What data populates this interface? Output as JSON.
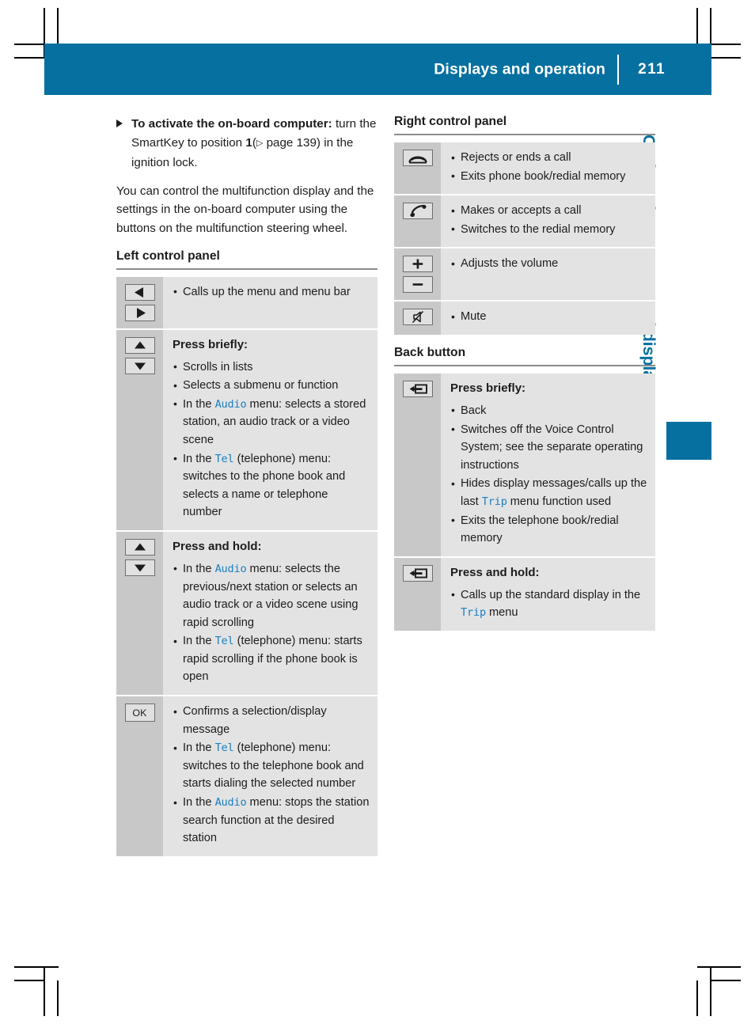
{
  "header": {
    "title": "Displays and operation",
    "page_number": "211",
    "accent_color": "#0670a0"
  },
  "side_tab": {
    "label": "On-board computer and displays",
    "color": "#0670a0"
  },
  "left_column": {
    "instruction": {
      "bold_lead": "To activate the on-board computer:",
      "rest_a": " turn the SmartKey to position ",
      "bold_one": "1",
      "rest_b": "(",
      "ref_marker": "▷",
      "ref_text": " page 139",
      "rest_c": ") in the ignition lock."
    },
    "paragraph": "You can control the multifunction display and the settings in the on-board computer using the buttons on the multifunction steering wheel.",
    "section_title": "Left control panel",
    "rows": [
      {
        "icons": [
          "arrow-left",
          "arrow-right"
        ],
        "heading": "",
        "items": [
          {
            "text": "Calls up the menu and menu bar"
          }
        ]
      },
      {
        "icons": [
          "arrow-up",
          "arrow-down"
        ],
        "heading": "Press briefly:",
        "items": [
          {
            "text": "Scrolls in lists"
          },
          {
            "text": "Selects a submenu or function"
          },
          {
            "pre": "In the ",
            "code": "Audio",
            "post": " menu: selects a stored station, an audio track or a video scene"
          },
          {
            "pre": "In the ",
            "code": "Tel",
            "post": " (telephone) menu: switches to the phone book and selects a name or telephone number"
          }
        ]
      },
      {
        "icons": [
          "arrow-up",
          "arrow-down"
        ],
        "heading": "Press and hold:",
        "items": [
          {
            "pre": "In the ",
            "code": "Audio",
            "post": " menu: selects the previous/next station or selects an audio track or a video scene using rapid scrolling"
          },
          {
            "pre": "In the ",
            "code": "Tel",
            "post": " (telephone) menu: starts rapid scrolling if the phone book is open"
          }
        ]
      },
      {
        "icons": [
          "ok"
        ],
        "heading": "",
        "items": [
          {
            "text": "Confirms a selection/display message"
          },
          {
            "pre": "In the ",
            "code": "Tel",
            "post": " (telephone) menu: switches to the telephone book and starts dialing the selected number"
          },
          {
            "pre": "In the ",
            "code": "Audio",
            "post": " menu: stops the station search function at the desired station"
          }
        ]
      }
    ]
  },
  "right_column": {
    "section_title_1": "Right control panel",
    "rows_1": [
      {
        "icons": [
          "phone-hangup"
        ],
        "heading": "",
        "items": [
          {
            "text": "Rejects or ends a call"
          },
          {
            "text": "Exits phone book/redial memory"
          }
        ]
      },
      {
        "icons": [
          "phone-pickup"
        ],
        "heading": "",
        "items": [
          {
            "text": "Makes or accepts a call"
          },
          {
            "text": "Switches to the redial memory"
          }
        ]
      },
      {
        "icons": [
          "volume-plus",
          "volume-minus"
        ],
        "heading": "",
        "items": [
          {
            "text": "Adjusts the volume"
          }
        ]
      },
      {
        "icons": [
          "mute"
        ],
        "heading": "",
        "items": [
          {
            "text": "Mute"
          }
        ]
      }
    ],
    "section_title_2": "Back button",
    "rows_2": [
      {
        "icons": [
          "back-arrow"
        ],
        "heading": "Press briefly:",
        "items": [
          {
            "text": "Back"
          },
          {
            "text": "Switches off the Voice Control System; see the separate operating instructions"
          },
          {
            "pre": "Hides display messages/calls up the last ",
            "code": "Trip",
            "post": " menu function used"
          },
          {
            "text": "Exits the telephone book/redial memory"
          }
        ]
      },
      {
        "icons": [
          "back-arrow"
        ],
        "heading": "Press and hold:",
        "items": [
          {
            "pre": "Calls up the standard display in the ",
            "code": "Trip",
            "post": " menu"
          }
        ]
      }
    ]
  }
}
